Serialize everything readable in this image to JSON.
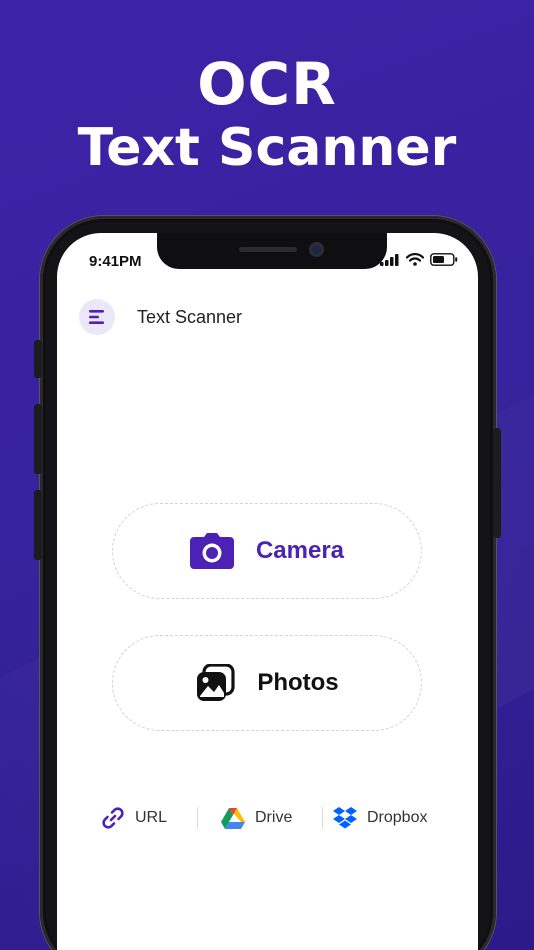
{
  "headline": {
    "line1": "OCR",
    "line2": "Text Scanner"
  },
  "status_bar": {
    "time": "9:41PM"
  },
  "app_bar": {
    "title": "Text Scanner",
    "menu_icon": "menu-icon"
  },
  "actions": [
    {
      "label": "Camera",
      "icon": "camera-icon",
      "color": "#4b22b5"
    },
    {
      "label": "Photos",
      "icon": "photos-icon",
      "color": "#111111"
    }
  ],
  "sources": [
    {
      "label": "URL",
      "icon": "link-icon"
    },
    {
      "label": "Drive",
      "icon": "google-drive-icon"
    },
    {
      "label": "Dropbox",
      "icon": "dropbox-icon"
    }
  ],
  "colors": {
    "background": "#3a24a3",
    "accent": "#4b22b5",
    "dropbox_blue": "#0061ff"
  }
}
